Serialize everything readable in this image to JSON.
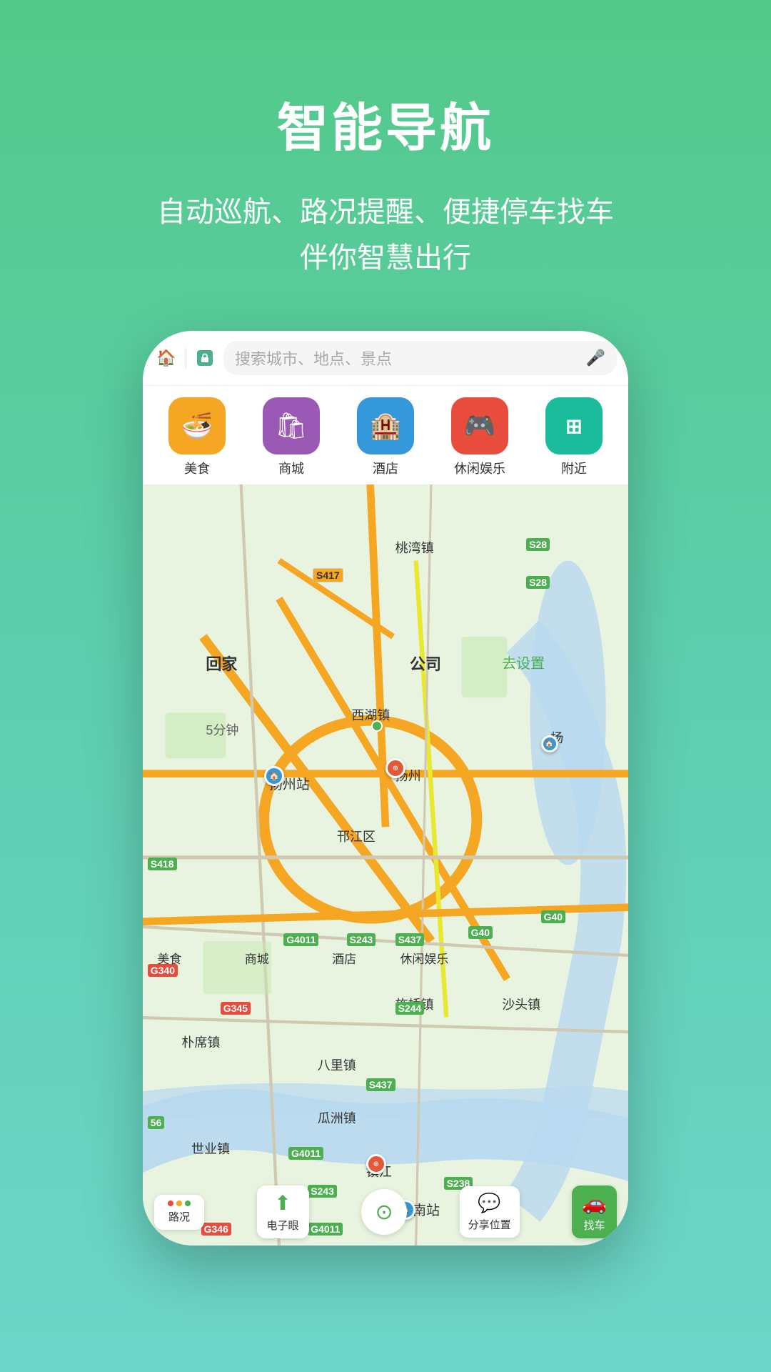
{
  "header": {
    "title": "智能导航",
    "subtitle_line1": "自动巡航、路况提醒、便捷停车找车",
    "subtitle_line2": "伴你智慧出行"
  },
  "search": {
    "placeholder": "搜索城市、地点、景点"
  },
  "categories": [
    {
      "label": "美食",
      "icon": "🍜",
      "class": "cat-food"
    },
    {
      "label": "商城",
      "icon": "🛍",
      "class": "cat-mall"
    },
    {
      "label": "酒店",
      "icon": "🏨",
      "class": "cat-hotel"
    },
    {
      "label": "休闲娱乐",
      "icon": "🎮",
      "class": "cat-leisure"
    },
    {
      "label": "附近",
      "icon": "⊞",
      "class": "cat-nearby"
    }
  ],
  "map_labels": [
    {
      "text": "桃湾镇",
      "top": "8%",
      "left": "52%"
    },
    {
      "text": "公司",
      "top": "24%",
      "left": "55%"
    },
    {
      "text": "回家",
      "top": "24%",
      "left": "15%"
    },
    {
      "text": "5分钟",
      "top": "33%",
      "left": "17%"
    },
    {
      "text": "去设置",
      "top": "24%",
      "left": "78%"
    },
    {
      "text": "西湖镇",
      "top": "30%",
      "left": "45%"
    },
    {
      "text": "扬州站",
      "top": "38%",
      "left": "30%"
    },
    {
      "text": "扬州",
      "top": "38%",
      "left": "55%"
    },
    {
      "text": "扬",
      "top": "34%",
      "left": "84%"
    },
    {
      "text": "邗江区",
      "top": "46%",
      "left": "42%"
    },
    {
      "text": "美食",
      "top": "61%",
      "left": "5%"
    },
    {
      "text": "商城",
      "top": "61%",
      "left": "22%"
    },
    {
      "text": "酒店",
      "top": "61%",
      "left": "40%"
    },
    {
      "text": "休闲娱乐",
      "top": "61%",
      "left": "55%"
    },
    {
      "text": "朴席镇",
      "top": "72%",
      "left": "10%"
    },
    {
      "text": "沙头镇",
      "top": "68%",
      "left": "78%"
    },
    {
      "text": "施桥镇",
      "top": "68%",
      "left": "55%"
    },
    {
      "text": "八里镇",
      "top": "75%",
      "left": "38%"
    },
    {
      "text": "世业镇",
      "top": "86%",
      "left": "12%"
    },
    {
      "text": "瓜洲镇",
      "top": "82%",
      "left": "38%"
    },
    {
      "text": "镇江",
      "top": "91%",
      "left": "48%"
    },
    {
      "text": "镇江南站",
      "top": "95%",
      "left": "52%"
    }
  ],
  "road_badges": [
    {
      "text": "S417",
      "top": "11%",
      "left": "36%",
      "type": "yellow"
    },
    {
      "text": "S28",
      "top": "8%",
      "left": "79%",
      "type": "green"
    },
    {
      "text": "S28",
      "top": "12%",
      "left": "79%",
      "type": "green"
    },
    {
      "text": "S418",
      "top": "48%",
      "left": "2%",
      "type": "green"
    },
    {
      "text": "G4011",
      "top": "58%",
      "left": "30%",
      "type": "green"
    },
    {
      "text": "S243",
      "top": "58%",
      "left": "42%",
      "type": "green"
    },
    {
      "text": "S437",
      "top": "58%",
      "left": "52%",
      "type": "green"
    },
    {
      "text": "G40",
      "top": "58%",
      "left": "68%",
      "type": "green"
    },
    {
      "text": "G40",
      "top": "58%",
      "left": "82%",
      "type": "green"
    },
    {
      "text": "G340",
      "top": "63%",
      "left": "2%",
      "type": "red"
    },
    {
      "text": "G345",
      "top": "68%",
      "left": "18%",
      "type": "red"
    },
    {
      "text": "S244",
      "top": "68%",
      "left": "52%",
      "type": "green"
    },
    {
      "text": "S437",
      "top": "78%",
      "left": "46%",
      "type": "green"
    },
    {
      "text": "56",
      "top": "83%",
      "left": "2%",
      "type": "green"
    },
    {
      "text": "G4011",
      "top": "88%",
      "left": "32%",
      "type": "green"
    },
    {
      "text": "S243",
      "top": "92%",
      "left": "36%",
      "type": "green"
    },
    {
      "text": "S238",
      "top": "91%",
      "left": "62%",
      "type": "green"
    },
    {
      "text": "G346",
      "top": "97%",
      "left": "14%",
      "type": "red"
    },
    {
      "text": "G4011",
      "top": "97%",
      "left": "36%",
      "type": "green"
    }
  ],
  "toolbar": {
    "traffic_label": "路况",
    "electronic_label": "电子眼",
    "share_label": "分享位置",
    "find_car_label": "找车"
  },
  "colors": {
    "bg_top": "#52c989",
    "bg_bottom": "#6dd5c8",
    "accent_green": "#4caf50"
  }
}
